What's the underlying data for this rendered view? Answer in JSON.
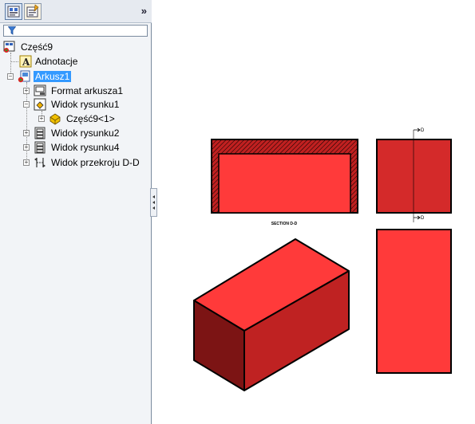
{
  "panel": {
    "collapse_glyph": "»",
    "tree": [
      {
        "label": "Część9",
        "icon": "part-icon"
      },
      {
        "label": "Adnotacje",
        "icon": "annotation-icon"
      },
      {
        "label": "Arkusz1",
        "icon": "sheet-icon",
        "selected": true
      },
      {
        "label": "Format arkusza1",
        "icon": "sheet-format-icon"
      },
      {
        "label": "Widok rysunku1",
        "icon": "drawing-view-icon"
      },
      {
        "label": "Część9<1>",
        "icon": "part-instance-icon"
      },
      {
        "label": "Widok rysunku2",
        "icon": "drawing-view-icon"
      },
      {
        "label": "Widok rysunku4",
        "icon": "drawing-view-icon"
      },
      {
        "label": "Widok przekroju D-D",
        "icon": "section-view-icon"
      }
    ]
  },
  "drawing": {
    "section_label": "SECTION D-D",
    "cut_marker_label": "D",
    "colors": {
      "fill": "#ff3a3a",
      "fill_dark": "#d42a2a",
      "side_fill": "#bf2222",
      "dark_side": "#7c1414",
      "hatch": "#c02020",
      "outline": "#000000"
    }
  }
}
